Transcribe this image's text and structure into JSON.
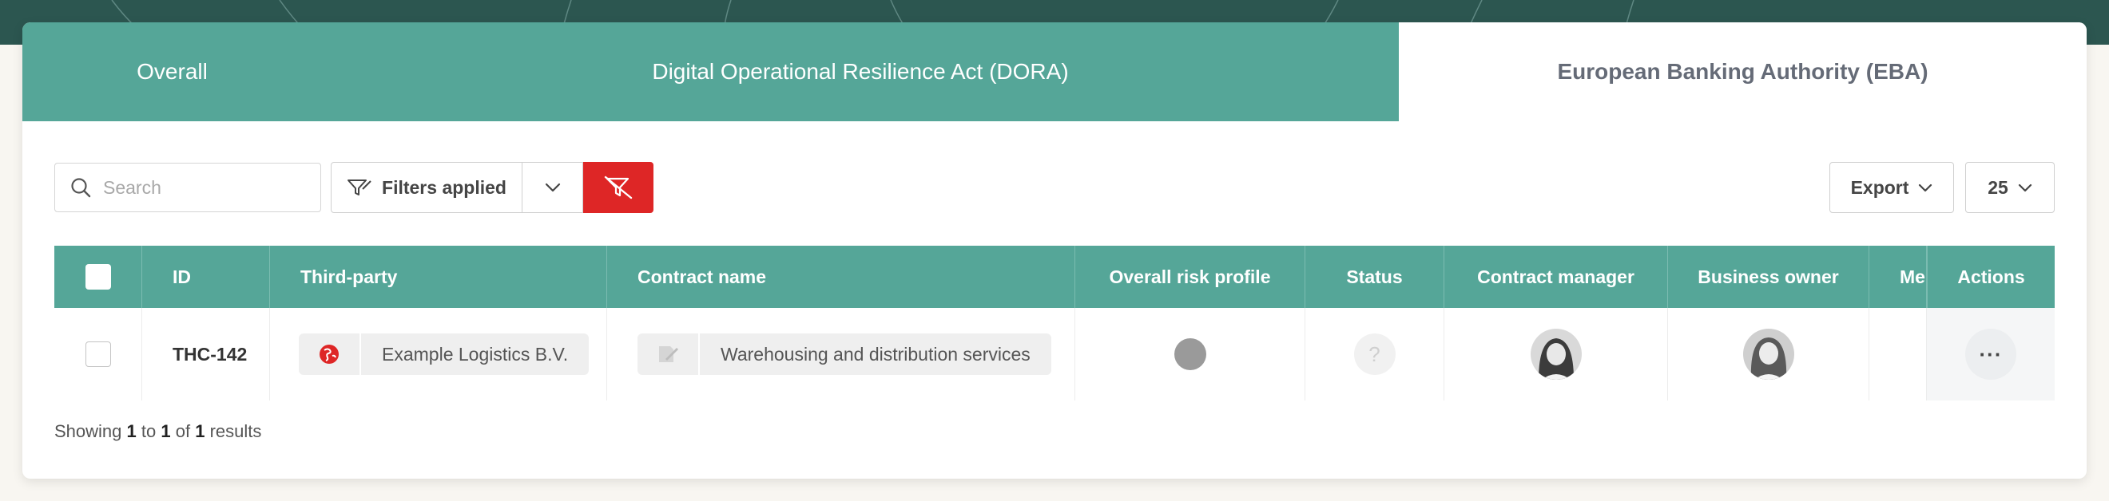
{
  "tabs": [
    {
      "label": "Overall",
      "active": false
    },
    {
      "label": "Digital Operational Resilience Act (DORA)",
      "active": false
    },
    {
      "label": "European Banking Authority (EBA)",
      "active": true
    }
  ],
  "toolbar": {
    "search_placeholder": "Search",
    "filters_label": "Filters applied",
    "export_label": "Export",
    "page_size": "25"
  },
  "table": {
    "columns": [
      "ID",
      "Third-party",
      "Contract name",
      "Overall risk profile",
      "Status",
      "Contract manager",
      "Business owner",
      "Me",
      "Actions"
    ],
    "rows": [
      {
        "id": "THC-142",
        "third_party": "Example Logistics B.V.",
        "contract_name": "Warehousing and distribution services",
        "status_symbol": "?",
        "actions_symbol": "···"
      }
    ]
  },
  "footer": {
    "showing": "Showing",
    "from": "1",
    "to_word": "to",
    "to": "1",
    "of_word": "of",
    "total": "1",
    "results_word": "results"
  },
  "colors": {
    "header_band": "#2c5650",
    "accent_teal": "#55a698",
    "danger_red": "#de2626"
  }
}
